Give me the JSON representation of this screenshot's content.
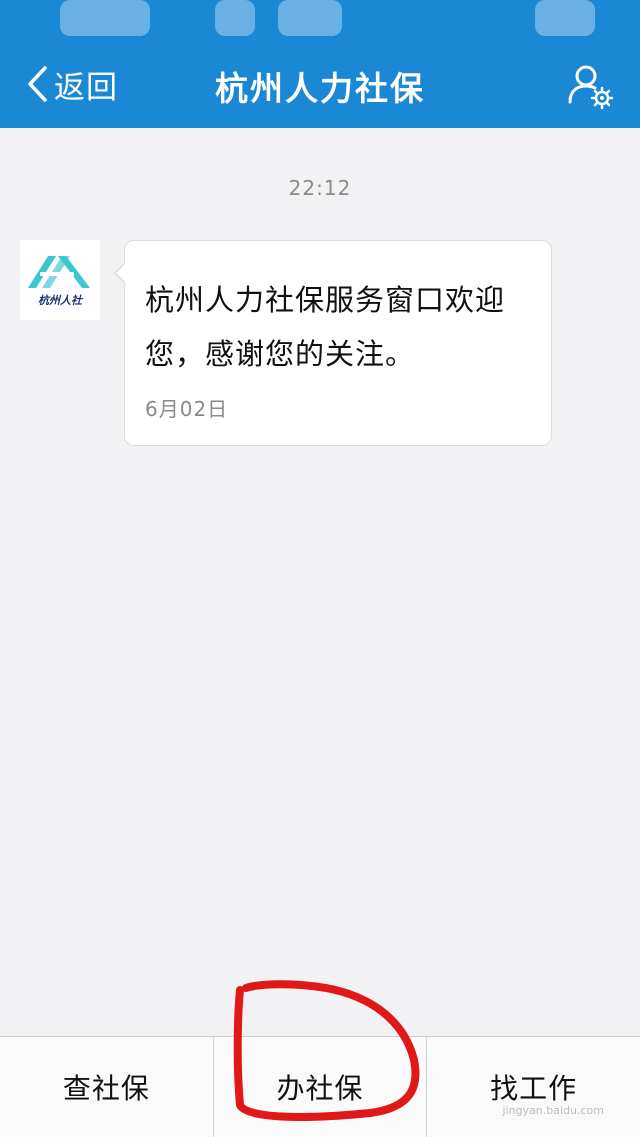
{
  "nav": {
    "back_label": "返回",
    "title": "杭州人力社保"
  },
  "chat": {
    "timestamp": "22:12",
    "sender_logo_text": "杭州人社",
    "message": "杭州人力社保服务窗口欢迎您，感谢您的关注。",
    "message_date": "6月02日"
  },
  "menu": {
    "items": [
      "查社保",
      "办社保",
      "找工作"
    ]
  },
  "watermark": "jingyan.baidu.com",
  "colors": {
    "nav_blue": "#1a88d4",
    "logo_teal": "#3cc7d0",
    "annotation_red": "#e01818"
  },
  "icons": [
    "chevron-left-icon",
    "user-settings-icon"
  ]
}
